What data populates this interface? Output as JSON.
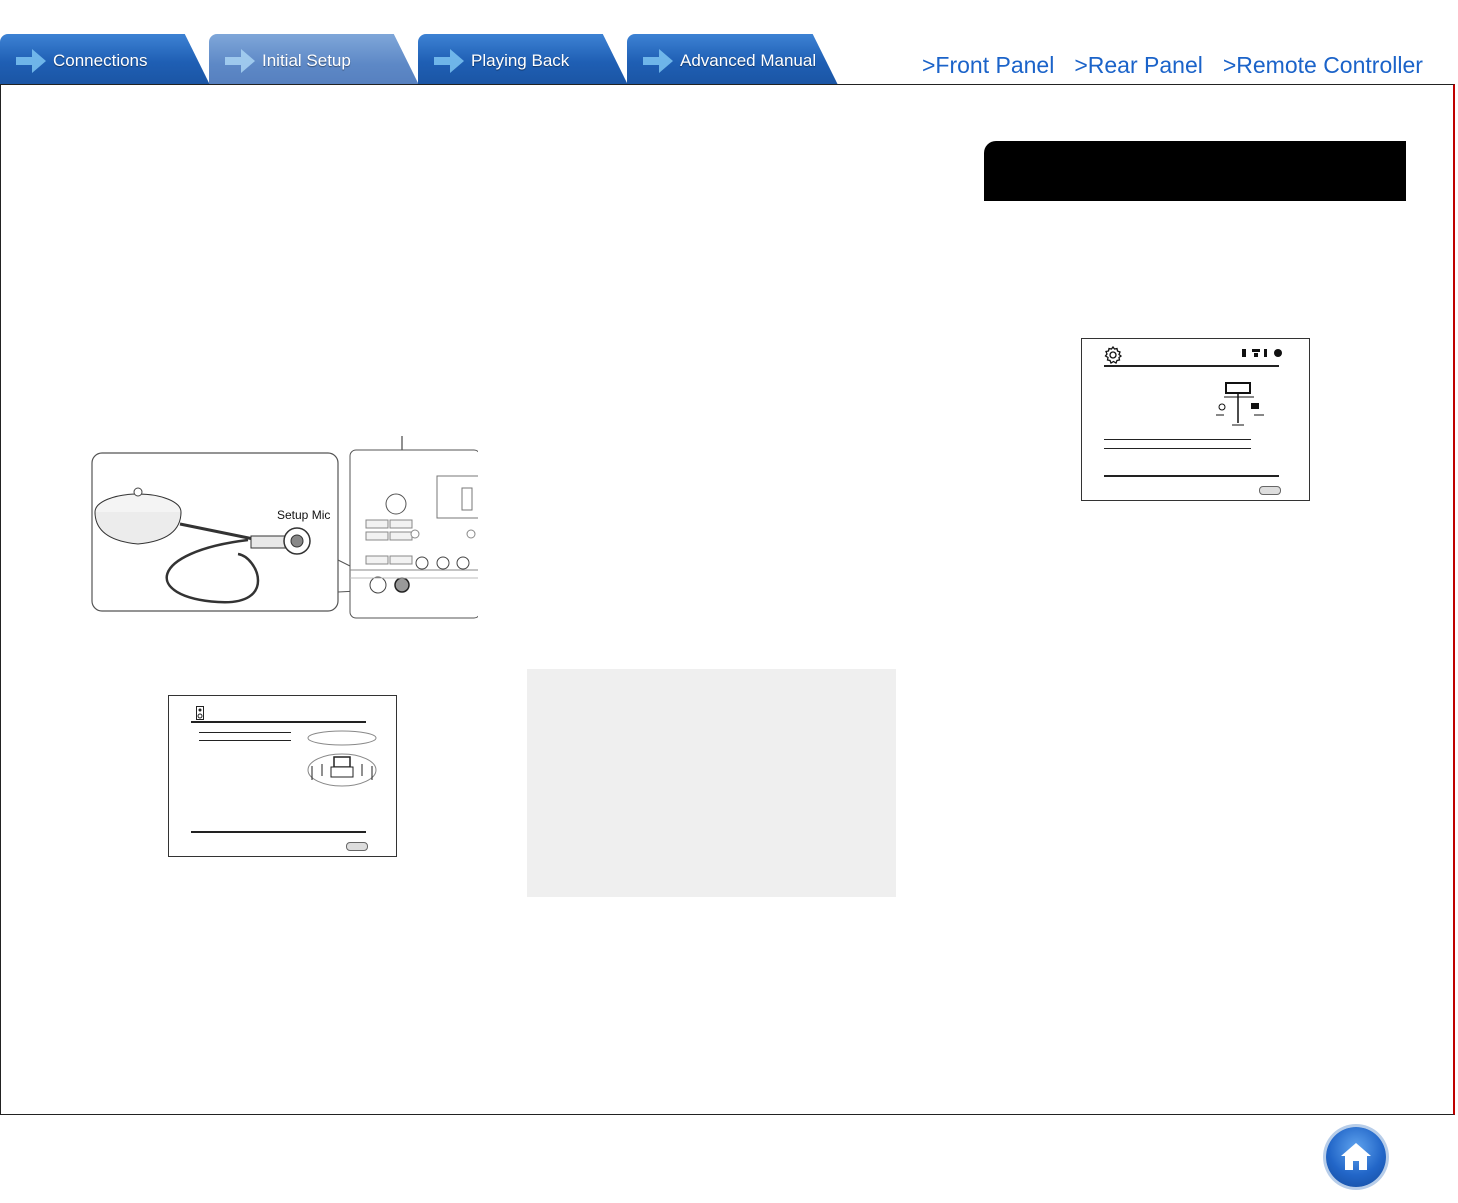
{
  "tabs": [
    {
      "label": "Connections",
      "active": false
    },
    {
      "label": "Initial Setup",
      "active": true
    },
    {
      "label": "Playing Back",
      "active": false
    },
    {
      "label": "Advanced Manual",
      "active": false
    }
  ],
  "nav_links": [
    ">Front Panel",
    ">Rear Panel",
    ">Remote Controller"
  ],
  "illustration": {
    "mic_label": "Setup Mic"
  },
  "icons": {
    "home": "home-icon",
    "tab_arrow": "arrow-right-icon",
    "settings": "gear-icon"
  },
  "colors": {
    "tab_blue": "#1f5fb4",
    "tab_active": "#5d88c6",
    "link_blue": "#1b63c9",
    "frame_red": "#c00000"
  }
}
